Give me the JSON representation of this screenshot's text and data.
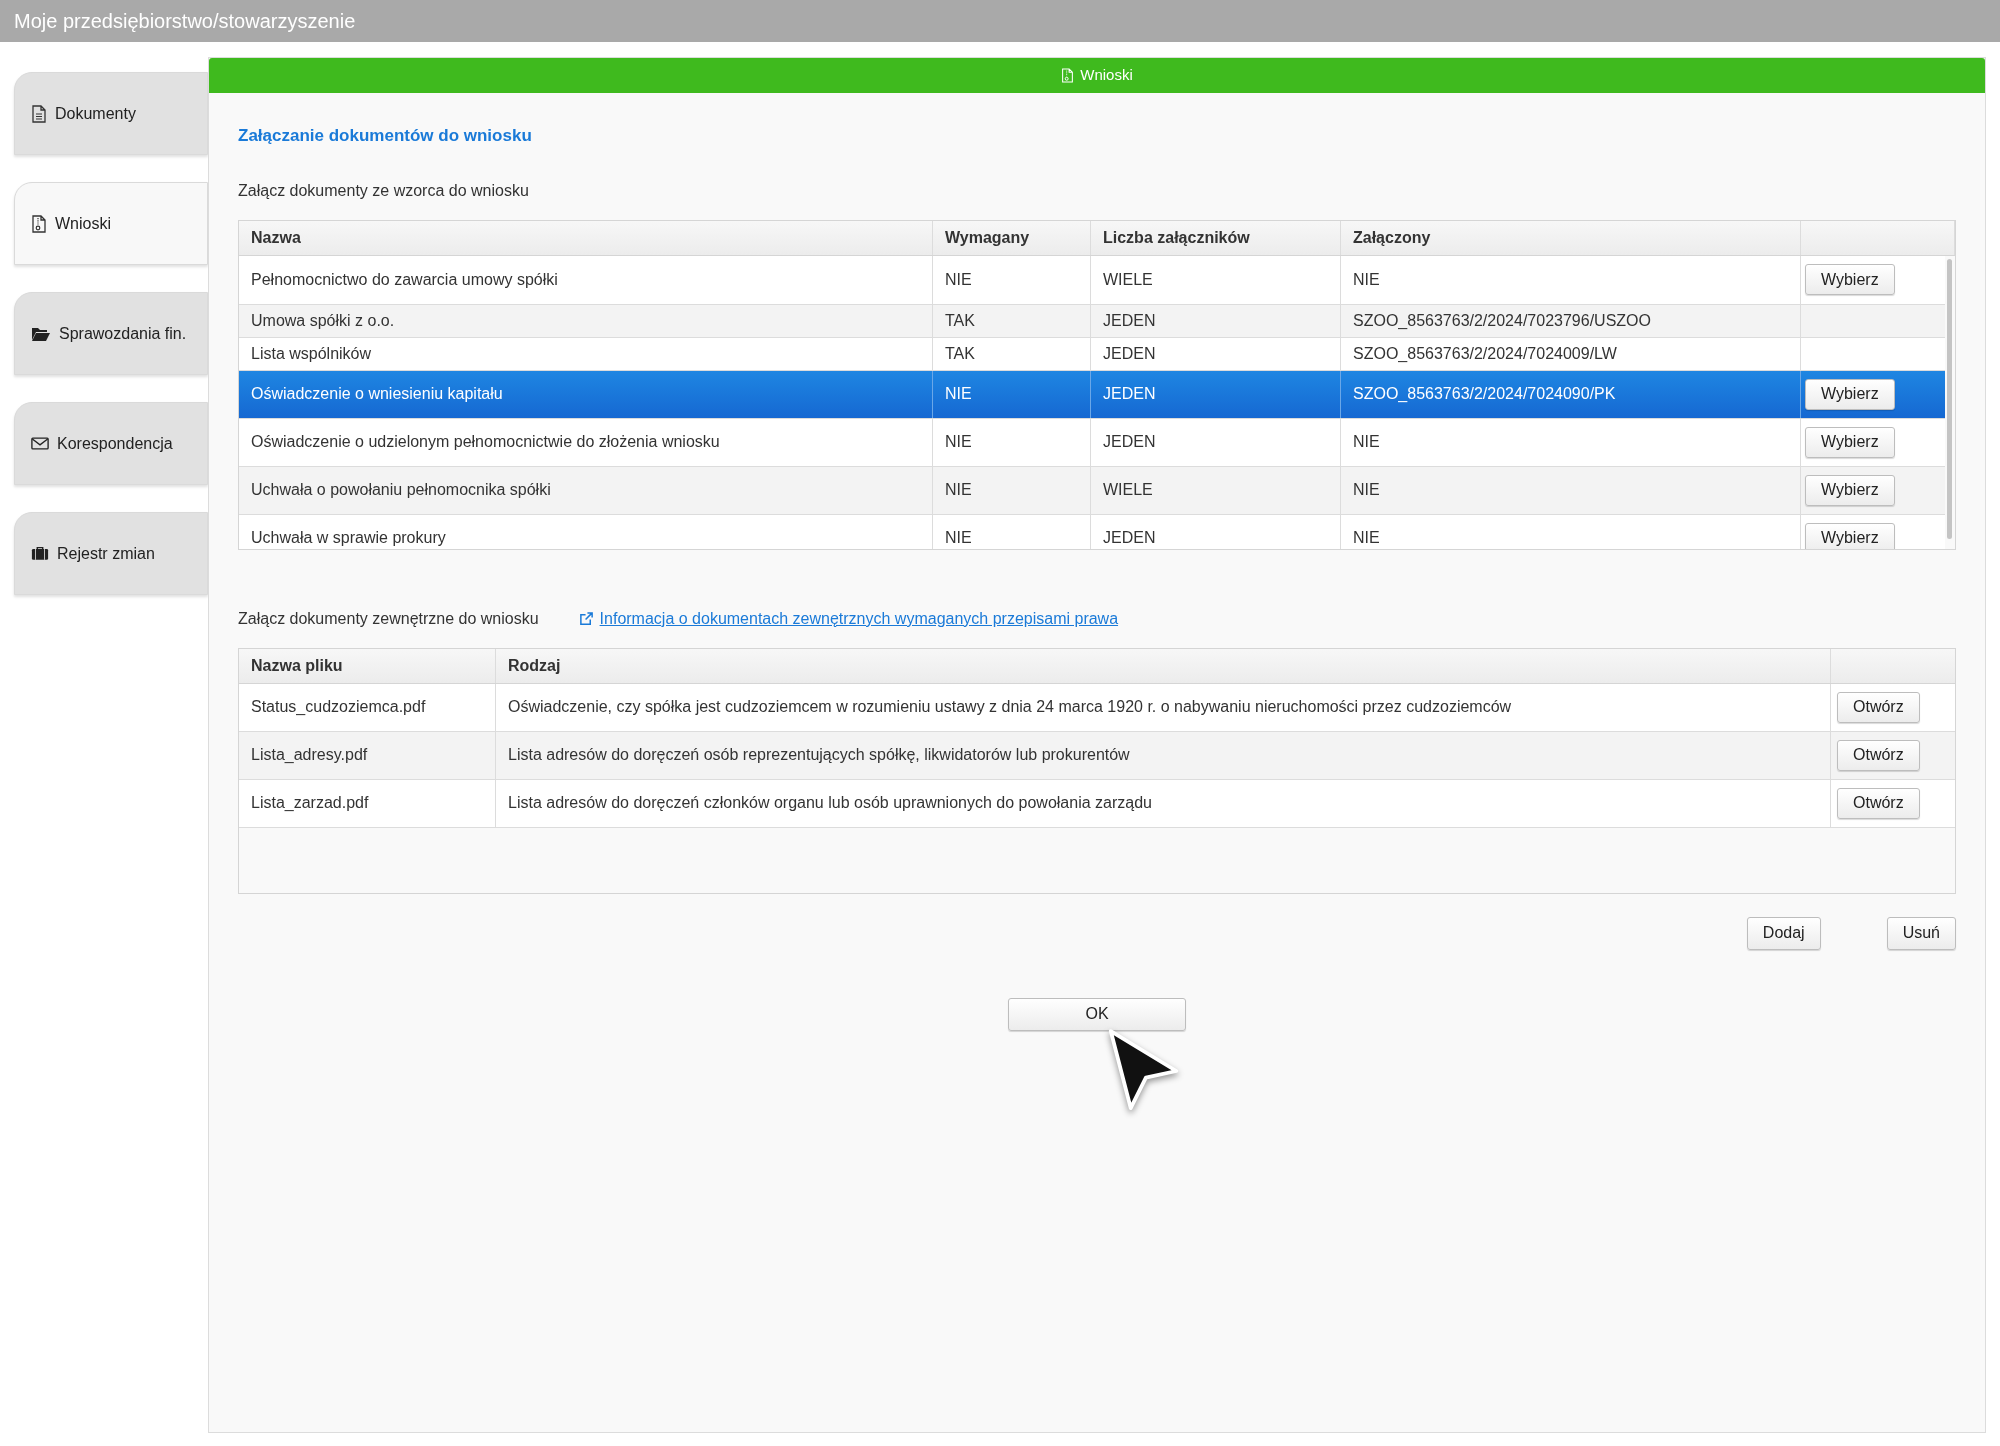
{
  "window": {
    "title": "Moje przedsiębiorstwo/stowarzyszenie"
  },
  "sidebar": {
    "items": [
      {
        "label": "Dokumenty",
        "selected": false
      },
      {
        "label": "Wnioski",
        "selected": true
      },
      {
        "label": "Sprawozdania fin.",
        "selected": false
      },
      {
        "label": "Korespondencja",
        "selected": false
      },
      {
        "label": "Rejestr zmian",
        "selected": false
      }
    ]
  },
  "panel": {
    "title": "Wnioski"
  },
  "heading": "Załączanie dokumentów do wniosku",
  "template_section": {
    "label": "Załącz dokumenty ze wzorca do wniosku",
    "columns": [
      "Nazwa",
      "Wymagany",
      "Liczba załączników",
      "Załączony"
    ],
    "rows": [
      {
        "name": "Pełnomocnictwo do zawarcia umowy spółki",
        "required": "NIE",
        "count": "WIELE",
        "attached": "NIE",
        "action": "Wybierz",
        "selected": false
      },
      {
        "name": "Umowa spółki z o.o.",
        "required": "TAK",
        "count": "JEDEN",
        "attached": "SZOO_8563763/2/2024/7023796/USZOO",
        "selected": false
      },
      {
        "name": "Lista wspólników",
        "required": "TAK",
        "count": "JEDEN",
        "attached": "SZOO_8563763/2/2024/7024009/LW",
        "selected": false
      },
      {
        "name": "Oświadczenie o wniesieniu kapitału",
        "required": "NIE",
        "count": "JEDEN",
        "attached": "SZOO_8563763/2/2024/7024090/PK",
        "action": "Wybierz",
        "selected": true
      },
      {
        "name": "Oświadczenie o udzielonym pełnomocnictwie do złożenia wniosku",
        "required": "NIE",
        "count": "JEDEN",
        "attached": "NIE",
        "action": "Wybierz",
        "selected": false
      },
      {
        "name": "Uchwała o powołaniu pełnomocnika spółki",
        "required": "NIE",
        "count": "WIELE",
        "attached": "NIE",
        "action": "Wybierz",
        "selected": false
      },
      {
        "name": "Uchwała w sprawie prokury",
        "required": "NIE",
        "count": "JEDEN",
        "attached": "NIE",
        "action": "Wybierz",
        "selected": false
      }
    ]
  },
  "external_section": {
    "label": "Załącz dokumenty zewnętrzne do wniosku",
    "link": "Informacja o dokumentach zewnętrznych wymaganych przepisami prawa",
    "columns": [
      "Nazwa pliku",
      "Rodzaj"
    ],
    "rows": [
      {
        "file": "Status_cudzoziemca.pdf",
        "type": "Oświadczenie, czy spółka jest cudzoziemcem w rozumieniu ustawy z dnia 24 marca 1920 r. o nabywaniu nieruchomości przez cudzoziemców",
        "action": "Otwórz"
      },
      {
        "file": "Lista_adresy.pdf",
        "type": "Lista adresów do doręczeń osób reprezentujących spółkę, likwidatorów lub prokurentów",
        "action": "Otwórz"
      },
      {
        "file": "Lista_zarzad.pdf",
        "type": "Lista adresów do doręczeń członków organu lub osób uprawnionych do powołania zarządu",
        "action": "Otwórz"
      }
    ],
    "buttons": [
      "Dodaj",
      "Usuń"
    ]
  },
  "ok_button": "OK"
}
